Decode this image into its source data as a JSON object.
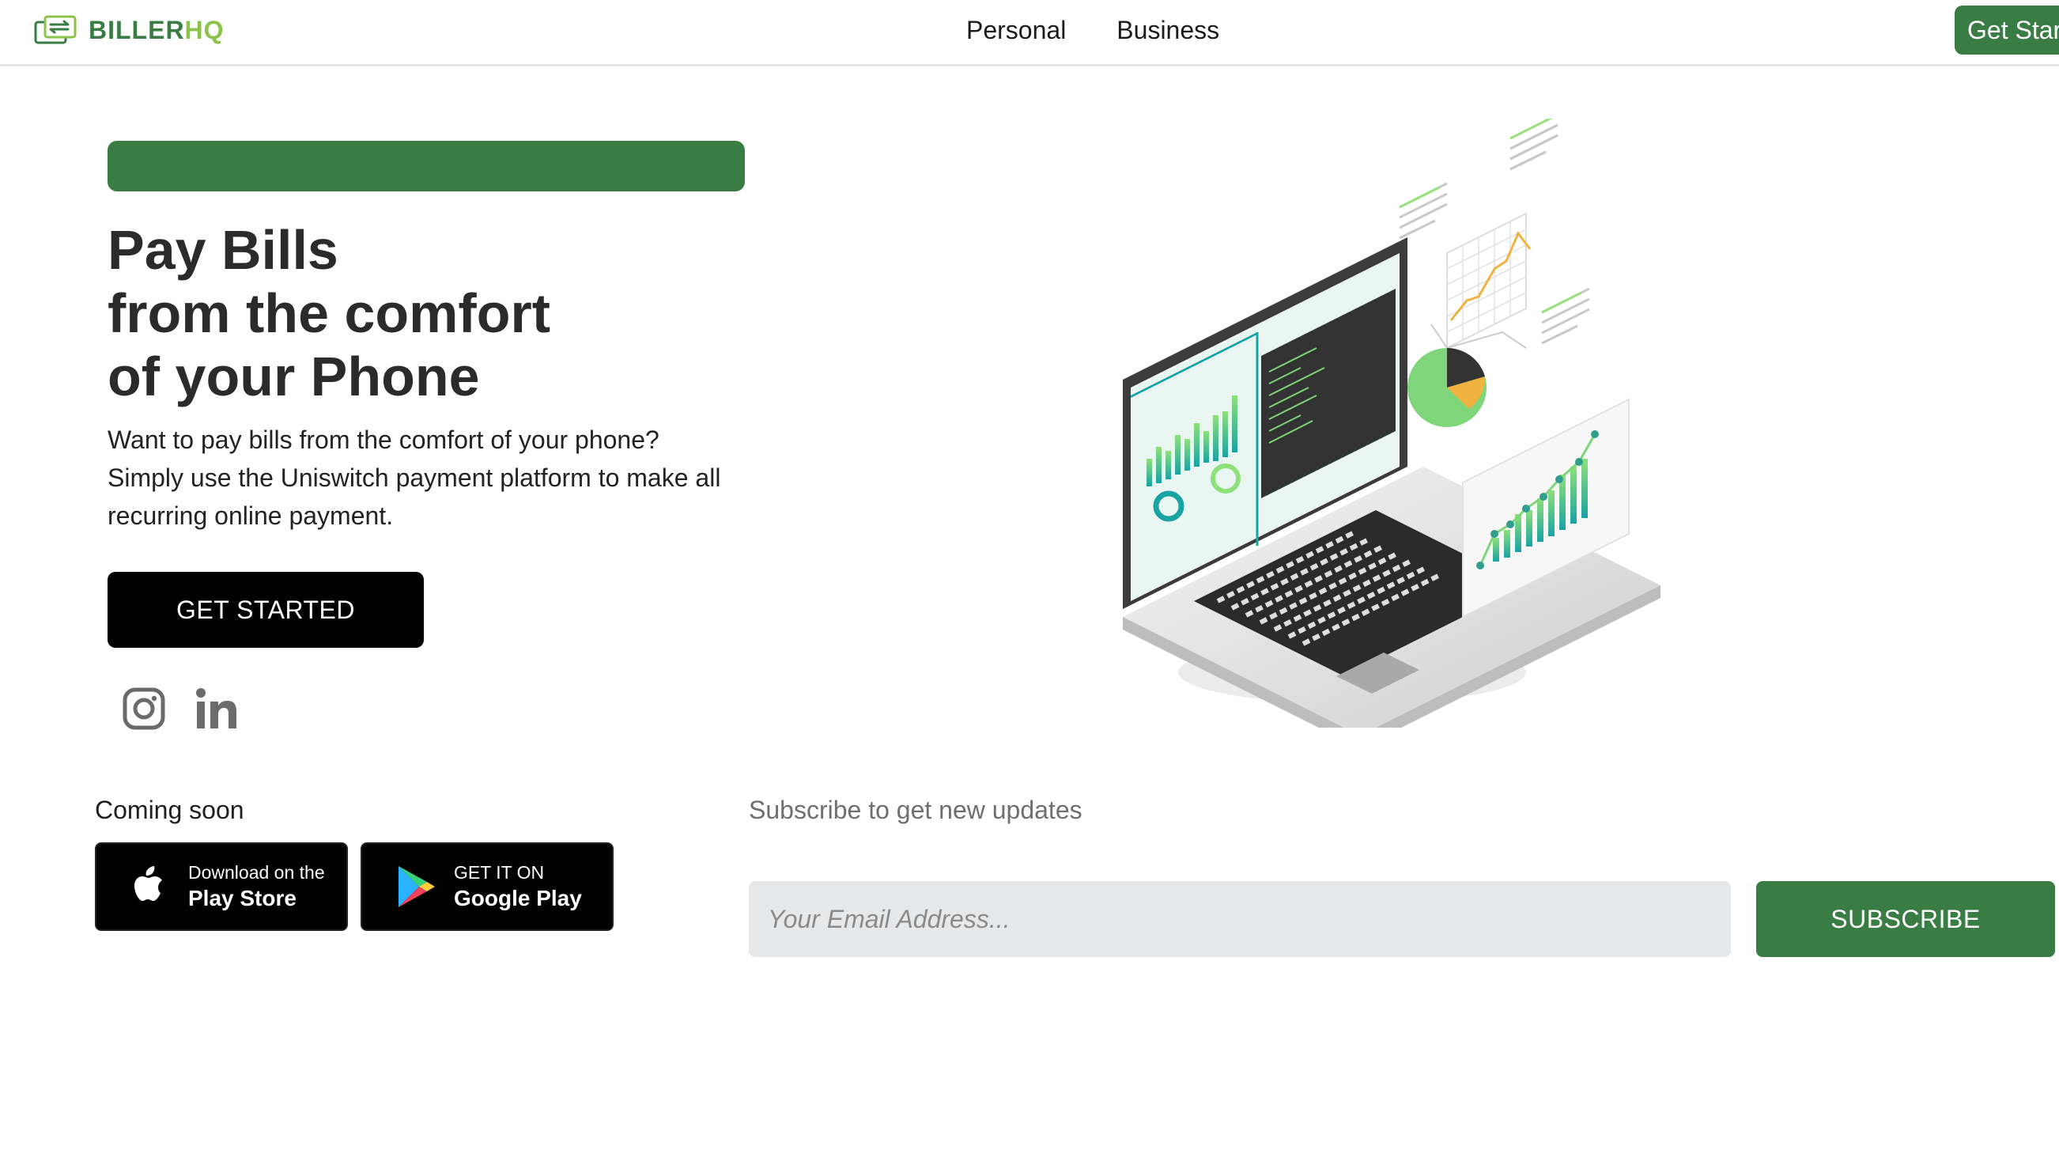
{
  "header": {
    "logo": {
      "brand_main": "BILLER",
      "brand_accent": "HQ",
      "icon": "exchange-card-icon"
    },
    "nav": [
      {
        "label": "Personal"
      },
      {
        "label": "Business"
      }
    ],
    "cta_label": "Get Star"
  },
  "hero": {
    "title_lines": [
      "Pay Bills",
      "from the comfort",
      "of your Phone"
    ],
    "description_lines": [
      "Want to pay bills from the comfort of your phone?",
      "Simply use the Uniswitch payment platform to make all",
      "recurring online payment."
    ],
    "cta_label": "GET STARTED",
    "social": [
      {
        "icon": "instagram-icon"
      },
      {
        "icon": "linkedin-icon"
      }
    ],
    "illustration": "isometric-laptop-dashboard-illustration"
  },
  "apps": {
    "label": "Coming soon",
    "stores": [
      {
        "small": "Download on the",
        "big": "Play Store",
        "icon": "apple-icon"
      },
      {
        "small": "GET IT ON",
        "big": "Google Play",
        "icon": "google-play-icon"
      }
    ]
  },
  "subscribe": {
    "label": "Subscribe to get new updates",
    "placeholder": "Your Email Address...",
    "button_label": "SUBSCRIBE"
  },
  "colors": {
    "brand_green": "#3a7d44",
    "accent_lime": "#8bc34a",
    "black": "#000000",
    "input_bg": "#e7e8ea"
  }
}
